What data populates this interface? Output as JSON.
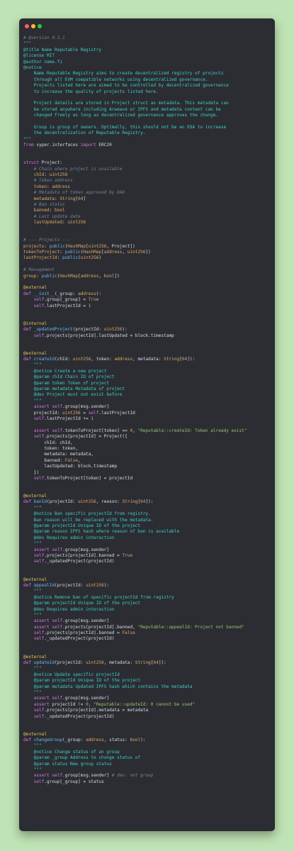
{
  "window": {
    "controls": [
      "close",
      "minimize",
      "maximize"
    ]
  },
  "colors": {
    "background": "#bfe3b4",
    "window": "#2b2d33",
    "comment": "#7b8190",
    "docstring": "#3ecfc0",
    "keyword": "#d774e2",
    "type": "#e6a960",
    "function": "#6fb6f5",
    "string": "#98c46a",
    "decorator": "#e6c35a"
  },
  "code_lines": [
    [
      [
        "cm",
        "# @version 0.3.1"
      ]
    ],
    [
      [
        "ds",
        "\"\"\""
      ]
    ],
    [
      [
        "ds",
        "@title Name Reputable Registry"
      ]
    ],
    [
      [
        "ds",
        "@license MIT"
      ]
    ],
    [
      [
        "ds",
        "@author name.fi"
      ]
    ],
    [
      [
        "ds",
        "@notice"
      ]
    ],
    [
      [
        "ds",
        "    Name Reputable Registry aims to create decentralized registry of projects"
      ]
    ],
    [
      [
        "ds",
        "    through all EVM compatible networks using decentralized governance."
      ]
    ],
    [
      [
        "ds",
        "    Projects listed here are aimed to be controlled by decentralized governance"
      ]
    ],
    [
      [
        "ds",
        "    to increase the quality of projects listed here."
      ]
    ],
    [
      [
        "ds",
        ""
      ]
    ],
    [
      [
        "ds",
        "    Project details are stored in Project struct as metadata. This metadata can"
      ]
    ],
    [
      [
        "ds",
        "    be stored anywhere including Arweave or IPFS and metadata content can be"
      ]
    ],
    [
      [
        "ds",
        "    changed freely as long as decentralized governance approves the change."
      ]
    ],
    [
      [
        "ds",
        ""
      ]
    ],
    [
      [
        "ds",
        "    Group is group of owners. Optimally, this should not be an EOA to increase"
      ]
    ],
    [
      [
        "ds",
        "    the decentralization of Reputable Registry."
      ]
    ],
    [
      [
        "ds",
        "\"\"\""
      ]
    ],
    [
      [
        "kw",
        "from"
      ],
      [
        "pl",
        " vyper.interfaces "
      ],
      [
        "kw",
        "import"
      ],
      [
        "pl",
        " ERC20"
      ]
    ],
    [
      [
        "pl",
        ""
      ]
    ],
    [
      [
        "pl",
        ""
      ]
    ],
    [
      [
        "kw",
        "struct"
      ],
      [
        "pl",
        " Project:"
      ]
    ],
    [
      [
        "pl",
        "    "
      ],
      [
        "cm",
        "# Chain where project is available"
      ]
    ],
    [
      [
        "ty",
        "    chId"
      ],
      [
        "pl",
        ": "
      ],
      [
        "ty",
        "uint256"
      ]
    ],
    [
      [
        "pl",
        "    "
      ],
      [
        "cm",
        "# Token address"
      ]
    ],
    [
      [
        "ty",
        "    token"
      ],
      [
        "pl",
        ": "
      ],
      [
        "ty",
        "address"
      ]
    ],
    [
      [
        "pl",
        "    "
      ],
      [
        "cm",
        "# Metadata of token approved by DAO"
      ]
    ],
    [
      [
        "ty",
        "    metadata"
      ],
      [
        "pl",
        ": "
      ],
      [
        "ty",
        "String"
      ],
      [
        "pl",
        "["
      ],
      [
        "nm",
        "64"
      ],
      [
        "pl",
        "]"
      ]
    ],
    [
      [
        "pl",
        "    "
      ],
      [
        "cm",
        "# Ban status"
      ]
    ],
    [
      [
        "ty",
        "    banned"
      ],
      [
        "pl",
        ": "
      ],
      [
        "ty",
        "bool"
      ]
    ],
    [
      [
        "pl",
        "    "
      ],
      [
        "cm",
        "# Last update date"
      ]
    ],
    [
      [
        "ty",
        "    lastUpdated"
      ],
      [
        "pl",
        ": "
      ],
      [
        "ty",
        "uint256"
      ]
    ],
    [
      [
        "pl",
        ""
      ]
    ],
    [
      [
        "pl",
        ""
      ]
    ],
    [
      [
        "cm",
        "# --- Projects ---"
      ]
    ],
    [
      [
        "ty",
        "projects"
      ],
      [
        "pl",
        ": "
      ],
      [
        "fn",
        "public"
      ],
      [
        "pl",
        "("
      ],
      [
        "ty",
        "HashMap"
      ],
      [
        "pl",
        "["
      ],
      [
        "ty",
        "uint256"
      ],
      [
        "pl",
        ", Project])"
      ]
    ],
    [
      [
        "ty",
        "tokenToProject"
      ],
      [
        "pl",
        ": "
      ],
      [
        "fn",
        "public"
      ],
      [
        "pl",
        "("
      ],
      [
        "ty",
        "HashMap"
      ],
      [
        "pl",
        "["
      ],
      [
        "ty",
        "address"
      ],
      [
        "pl",
        ", "
      ],
      [
        "ty",
        "uint256"
      ],
      [
        "pl",
        "])"
      ]
    ],
    [
      [
        "ty",
        "lastProjectId"
      ],
      [
        "pl",
        ": "
      ],
      [
        "fn",
        "public"
      ],
      [
        "pl",
        "("
      ],
      [
        "ty",
        "uint256"
      ],
      [
        "pl",
        ")"
      ]
    ],
    [
      [
        "pl",
        ""
      ]
    ],
    [
      [
        "cm",
        "# Management"
      ]
    ],
    [
      [
        "ty",
        "group"
      ],
      [
        "pl",
        ": "
      ],
      [
        "fn",
        "public"
      ],
      [
        "pl",
        "("
      ],
      [
        "ty",
        "HashMap"
      ],
      [
        "pl",
        "["
      ],
      [
        "ty",
        "address"
      ],
      [
        "pl",
        ", "
      ],
      [
        "ty",
        "bool"
      ],
      [
        "pl",
        "])"
      ]
    ],
    [
      [
        "pl",
        ""
      ]
    ],
    [
      [
        "dc",
        "@external"
      ]
    ],
    [
      [
        "kw",
        "def"
      ],
      [
        "pl",
        " "
      ],
      [
        "fn",
        "__init__"
      ],
      [
        "pl",
        "(_group: "
      ],
      [
        "ty",
        "address"
      ],
      [
        "pl",
        "):"
      ]
    ],
    [
      [
        "pl",
        "    "
      ],
      [
        "kw",
        "self"
      ],
      [
        "pl",
        ".group[_group] = "
      ],
      [
        "nm",
        "True"
      ]
    ],
    [
      [
        "pl",
        "    "
      ],
      [
        "kw",
        "self"
      ],
      [
        "pl",
        ".lastProjectId = "
      ],
      [
        "nm",
        "1"
      ]
    ],
    [
      [
        "pl",
        ""
      ]
    ],
    [
      [
        "pl",
        ""
      ]
    ],
    [
      [
        "dc",
        "@internal"
      ]
    ],
    [
      [
        "kw",
        "def"
      ],
      [
        "pl",
        " "
      ],
      [
        "fn",
        "_updatedProject"
      ],
      [
        "pl",
        "(projectId: "
      ],
      [
        "ty",
        "uint256"
      ],
      [
        "pl",
        "):"
      ]
    ],
    [
      [
        "pl",
        "    "
      ],
      [
        "kw",
        "self"
      ],
      [
        "pl",
        ".projects[projectId].lastUpdated = block.timestamp"
      ]
    ],
    [
      [
        "pl",
        ""
      ]
    ],
    [
      [
        "pl",
        ""
      ]
    ],
    [
      [
        "dc",
        "@external"
      ]
    ],
    [
      [
        "kw",
        "def"
      ],
      [
        "pl",
        " "
      ],
      [
        "fn",
        "createId"
      ],
      [
        "pl",
        "(chId: "
      ],
      [
        "ty",
        "uint256"
      ],
      [
        "pl",
        ", token: "
      ],
      [
        "ty",
        "address"
      ],
      [
        "pl",
        ", metadata: "
      ],
      [
        "ty",
        "String"
      ],
      [
        "pl",
        "["
      ],
      [
        "nm",
        "64"
      ],
      [
        "pl",
        "]):"
      ]
    ],
    [
      [
        "ds",
        "    \"\"\""
      ]
    ],
    [
      [
        "ds",
        "    @notice Create a new project"
      ]
    ],
    [
      [
        "ds",
        "    @param chId Chain ID of project"
      ]
    ],
    [
      [
        "ds",
        "    @param token Token of project"
      ]
    ],
    [
      [
        "ds",
        "    @param metadata Metadata of project"
      ]
    ],
    [
      [
        "ds",
        "    @dev Project must not exist before"
      ]
    ],
    [
      [
        "ds",
        "    \"\"\""
      ]
    ],
    [
      [
        "pl",
        "    "
      ],
      [
        "kw",
        "assert"
      ],
      [
        "pl",
        " "
      ],
      [
        "kw",
        "self"
      ],
      [
        "pl",
        ".group[msg.sender]"
      ]
    ],
    [
      [
        "pl",
        "    projectId: "
      ],
      [
        "ty",
        "uint256"
      ],
      [
        "pl",
        " = "
      ],
      [
        "kw",
        "self"
      ],
      [
        "pl",
        ".lastProjectId"
      ]
    ],
    [
      [
        "pl",
        "    "
      ],
      [
        "kw",
        "self"
      ],
      [
        "pl",
        ".lastProjectId += "
      ],
      [
        "nm",
        "1"
      ]
    ],
    [
      [
        "pl",
        ""
      ]
    ],
    [
      [
        "pl",
        "    "
      ],
      [
        "kw",
        "assert"
      ],
      [
        "pl",
        " "
      ],
      [
        "kw",
        "self"
      ],
      [
        "pl",
        ".tokenToProject[token] == "
      ],
      [
        "nm",
        "0"
      ],
      [
        "pl",
        ", "
      ],
      [
        "st",
        "\"Reputable::createId: Token already exist\""
      ]
    ],
    [
      [
        "pl",
        "    "
      ],
      [
        "kw",
        "self"
      ],
      [
        "pl",
        ".projects[projectId] = Project({"
      ]
    ],
    [
      [
        "pl",
        "        chId: chId,"
      ]
    ],
    [
      [
        "pl",
        "        token: token,"
      ]
    ],
    [
      [
        "pl",
        "        metadata: metadata,"
      ]
    ],
    [
      [
        "pl",
        "        banned: "
      ],
      [
        "nm",
        "False"
      ],
      [
        "pl",
        ","
      ]
    ],
    [
      [
        "pl",
        "        lastUpdated: block.timestamp"
      ]
    ],
    [
      [
        "pl",
        "    })"
      ]
    ],
    [
      [
        "pl",
        "    "
      ],
      [
        "kw",
        "self"
      ],
      [
        "pl",
        ".tokenToProject[token] = projectId"
      ]
    ],
    [
      [
        "pl",
        ""
      ]
    ],
    [
      [
        "pl",
        ""
      ]
    ],
    [
      [
        "dc",
        "@external"
      ]
    ],
    [
      [
        "kw",
        "def"
      ],
      [
        "pl",
        " "
      ],
      [
        "fn",
        "banId"
      ],
      [
        "pl",
        "(projectId: "
      ],
      [
        "ty",
        "uint256"
      ],
      [
        "pl",
        ", reason: "
      ],
      [
        "ty",
        "String"
      ],
      [
        "pl",
        "["
      ],
      [
        "nm",
        "64"
      ],
      [
        "pl",
        "]):"
      ]
    ],
    [
      [
        "ds",
        "    \"\"\""
      ]
    ],
    [
      [
        "ds",
        "    @notice Ban specific projectId from registry."
      ]
    ],
    [
      [
        "ds",
        "    Ban reason will be replaced with the metadata."
      ]
    ],
    [
      [
        "ds",
        "    @param projectId Unique ID of the project"
      ]
    ],
    [
      [
        "ds",
        "    @param reason IPFS hash where reason of ban is available"
      ]
    ],
    [
      [
        "ds",
        "    @dev Requires admin interaction"
      ]
    ],
    [
      [
        "ds",
        "    \"\"\""
      ]
    ],
    [
      [
        "pl",
        "    "
      ],
      [
        "kw",
        "assert"
      ],
      [
        "pl",
        " "
      ],
      [
        "kw",
        "self"
      ],
      [
        "pl",
        ".group[msg.sender]"
      ]
    ],
    [
      [
        "pl",
        "    "
      ],
      [
        "kw",
        "self"
      ],
      [
        "pl",
        ".projects[projectId].banned = "
      ],
      [
        "nm",
        "True"
      ]
    ],
    [
      [
        "pl",
        "    "
      ],
      [
        "kw",
        "self"
      ],
      [
        "pl",
        "._updatedProject(projectId)"
      ]
    ],
    [
      [
        "pl",
        ""
      ]
    ],
    [
      [
        "pl",
        ""
      ]
    ],
    [
      [
        "dc",
        "@external"
      ]
    ],
    [
      [
        "kw",
        "def"
      ],
      [
        "pl",
        " "
      ],
      [
        "fn",
        "appealId"
      ],
      [
        "pl",
        "(projectId: "
      ],
      [
        "ty",
        "uint256"
      ],
      [
        "pl",
        "):"
      ]
    ],
    [
      [
        "ds",
        "    \"\"\""
      ]
    ],
    [
      [
        "ds",
        "    @notice Remove ban of specific projectId from registry"
      ]
    ],
    [
      [
        "ds",
        "    @param projectId Unique ID of the project"
      ]
    ],
    [
      [
        "ds",
        "    @dev Requires admin interaction"
      ]
    ],
    [
      [
        "ds",
        "    \"\"\""
      ]
    ],
    [
      [
        "pl",
        "    "
      ],
      [
        "kw",
        "assert"
      ],
      [
        "pl",
        " "
      ],
      [
        "kw",
        "self"
      ],
      [
        "pl",
        ".group[msg.sender]"
      ]
    ],
    [
      [
        "pl",
        "    "
      ],
      [
        "kw",
        "assert"
      ],
      [
        "pl",
        " "
      ],
      [
        "kw",
        "self"
      ],
      [
        "pl",
        ".projects[projectId].banned, "
      ],
      [
        "st",
        "\"Reputable::appealId: Project not banned\""
      ]
    ],
    [
      [
        "pl",
        "    "
      ],
      [
        "kw",
        "self"
      ],
      [
        "pl",
        ".projects[projectId].banned = "
      ],
      [
        "nm",
        "False"
      ]
    ],
    [
      [
        "pl",
        "    "
      ],
      [
        "kw",
        "self"
      ],
      [
        "pl",
        "._updatedProject(projectId)"
      ]
    ],
    [
      [
        "pl",
        ""
      ]
    ],
    [
      [
        "pl",
        ""
      ]
    ],
    [
      [
        "dc",
        "@external"
      ]
    ],
    [
      [
        "kw",
        "def"
      ],
      [
        "pl",
        " "
      ],
      [
        "fn",
        "updateId"
      ],
      [
        "pl",
        "(projectId: "
      ],
      [
        "ty",
        "uint256"
      ],
      [
        "pl",
        ", metadata: "
      ],
      [
        "ty",
        "String"
      ],
      [
        "pl",
        "["
      ],
      [
        "nm",
        "64"
      ],
      [
        "pl",
        "]):"
      ]
    ],
    [
      [
        "ds",
        "    \"\"\""
      ]
    ],
    [
      [
        "ds",
        "    @notice Update specific projectId"
      ]
    ],
    [
      [
        "ds",
        "    @param projectId Unique ID of the project"
      ]
    ],
    [
      [
        "ds",
        "    @param metadata Updated IPFS hash which contains the metadata"
      ]
    ],
    [
      [
        "ds",
        "    \"\"\""
      ]
    ],
    [
      [
        "pl",
        "    "
      ],
      [
        "kw",
        "assert"
      ],
      [
        "pl",
        " "
      ],
      [
        "kw",
        "self"
      ],
      [
        "pl",
        ".group[msg.sender]"
      ]
    ],
    [
      [
        "pl",
        "    "
      ],
      [
        "kw",
        "assert"
      ],
      [
        "pl",
        " projectId != "
      ],
      [
        "nm",
        "0"
      ],
      [
        "pl",
        ", "
      ],
      [
        "st",
        "\"Reputable::updateId: 0 cannot be used\""
      ]
    ],
    [
      [
        "pl",
        "    "
      ],
      [
        "kw",
        "self"
      ],
      [
        "pl",
        ".projects[projectId].metadata = metadata"
      ]
    ],
    [
      [
        "pl",
        "    "
      ],
      [
        "kw",
        "self"
      ],
      [
        "pl",
        "._updatedProject(projectId)"
      ]
    ],
    [
      [
        "pl",
        ""
      ]
    ],
    [
      [
        "pl",
        ""
      ]
    ],
    [
      [
        "dc",
        "@external"
      ]
    ],
    [
      [
        "kw",
        "def"
      ],
      [
        "pl",
        " "
      ],
      [
        "fn",
        "changeGroup"
      ],
      [
        "pl",
        "(_group: "
      ],
      [
        "ty",
        "address"
      ],
      [
        "pl",
        ", status: "
      ],
      [
        "ty",
        "bool"
      ],
      [
        "pl",
        "):"
      ]
    ],
    [
      [
        "ds",
        "    \"\"\""
      ]
    ],
    [
      [
        "ds",
        "    @notice Change status of an group"
      ]
    ],
    [
      [
        "ds",
        "    @param _group Address to change status of"
      ]
    ],
    [
      [
        "ds",
        "    @param status New group status"
      ]
    ],
    [
      [
        "ds",
        "    \"\"\""
      ]
    ],
    [
      [
        "pl",
        "    "
      ],
      [
        "kw",
        "assert"
      ],
      [
        "pl",
        " "
      ],
      [
        "kw",
        "self"
      ],
      [
        "pl",
        ".group[msg.sender] "
      ],
      [
        "cm",
        "# dev: not group"
      ]
    ],
    [
      [
        "pl",
        "    "
      ],
      [
        "kw",
        "self"
      ],
      [
        "pl",
        ".group[_group] = status"
      ]
    ]
  ]
}
